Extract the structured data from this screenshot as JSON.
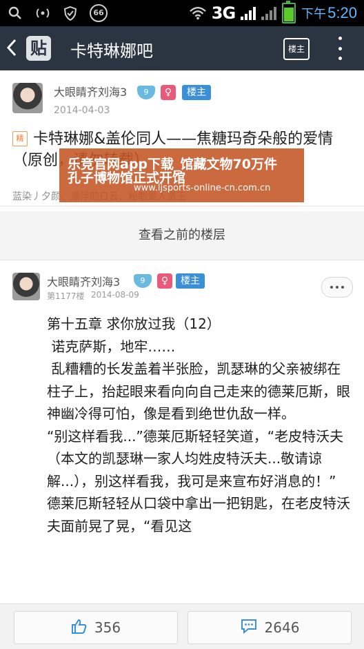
{
  "status_bar": {
    "network": "3G",
    "ampm": "下午",
    "time": "5:20",
    "notification_count": "66"
  },
  "navbar": {
    "logo": "贴",
    "title": "卡特琳娜吧",
    "louzhu_button": "楼主"
  },
  "post1": {
    "username": "大眼睛齐刘海3",
    "level": "9",
    "gender": "♀",
    "role_badge": "楼主",
    "date": "2014-04-03",
    "jing_badge": "精",
    "title": "卡特琳娜&盖伦同人——焦糖玛奇朵般的爱情（原创，请勿转载）",
    "author_line": "蓝染丿夕颜、漂浮的白云、秘制爱人贤王"
  },
  "ad_overlay": {
    "line1": "乐竞官网app下载_馆藏文物70万件",
    "line2": "孔子博物馆正式开馆",
    "line3": "www.ljsports-online-cn.com.cn"
  },
  "previous_floors": "查看之前的楼层",
  "post2": {
    "username": "大眼睛齐刘海3",
    "level": "9",
    "gender": "♀",
    "role_badge": "楼主",
    "floor": "第1177楼",
    "date": "2014-08-09",
    "paragraphs": [
      "第十五章 求你放过我（12）",
      " 诺克萨斯，地牢……",
      " 乱糟糟的长发盖着半张脸，凯瑟琳的父亲被绑在柱子上，抬起眼来看向向自己走来的德莱厄斯，眼神幽冷得可怕，像是看到绝世仇敌一样。",
      "“别这样看我...”德莱厄斯轻轻笑道，“老皮特沃夫（本文的凯瑟琳一家人均姓皮特沃夫...敬请谅解...），别这样看我，我可是来宣布好消息的！”",
      "德莱厄斯轻轻从口袋中拿出一把钥匙，在老皮特沃夫面前晃了晃，“看见这"
    ]
  },
  "bottom_bar": {
    "likes": "356",
    "comments": "2646"
  },
  "colors": {
    "navbar_bg": "#2b3441",
    "level_badge": "#69b9e0",
    "female_badge": "#e8597a",
    "louzhu_badge": "#3a8fd6",
    "ad_bg": "#c45424",
    "time_color": "#5fb6ff"
  },
  "icons": [
    "search-icon",
    "wifi-signal-icon",
    "shield-icon",
    "notification-count-icon",
    "wifi-icon",
    "cell-signal-icon",
    "battery-icon",
    "back-icon",
    "more-vertical-icon",
    "more-horizontal-icon",
    "thumbs-up-icon",
    "comment-icon"
  ]
}
